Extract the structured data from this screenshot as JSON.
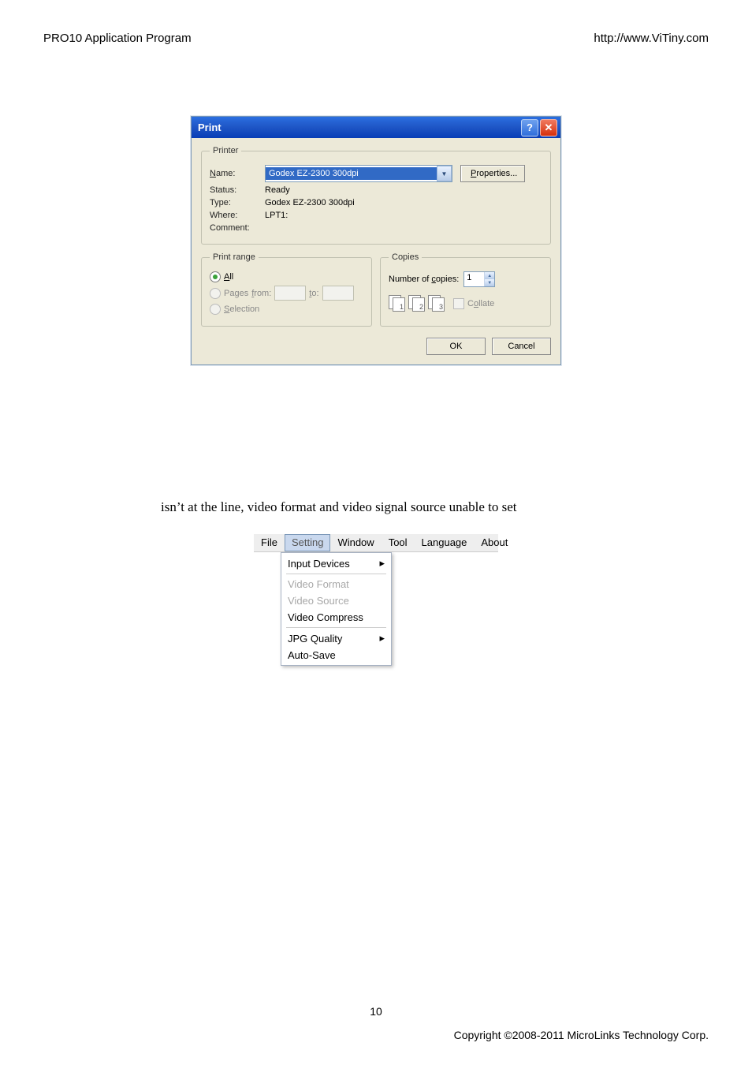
{
  "header": {
    "left": "PRO10 Application Program",
    "right": "http://www.ViTiny.com"
  },
  "dialog": {
    "title": "Print",
    "printer_group": "Printer",
    "name_label": "Name:",
    "name_value": "Godex EZ-2300 300dpi",
    "properties_btn": "Properties...",
    "status_label": "Status:",
    "status_value": "Ready",
    "type_label": "Type:",
    "type_value": "Godex EZ-2300 300dpi",
    "where_label": "Where:",
    "where_value": "LPT1:",
    "comment_label": "Comment:",
    "comment_value": "",
    "range_group": "Print range",
    "range_all": "All",
    "range_pages": "Pages",
    "range_from": "from:",
    "range_to": "to:",
    "range_selection": "Selection",
    "copies_group": "Copies",
    "copies_label": "Number of copies:",
    "copies_value": "1",
    "collate_label": "Collate",
    "icon_pages": {
      "a": "1",
      "b": "2",
      "c": "3"
    },
    "ok": "OK",
    "cancel": "Cancel"
  },
  "paragraph": "isn’t at the line, video format and video signal source unable to set",
  "menu": {
    "bar": [
      "File",
      "Setting",
      "Window",
      "Tool",
      "Language",
      "About"
    ],
    "items": {
      "input_devices": "Input Devices",
      "video_format": "Video Format",
      "video_source": "Video Source",
      "video_compress": "Video Compress",
      "jpg_quality": "JPG Quality",
      "auto_save": "Auto-Save"
    }
  },
  "footer": {
    "page": "10",
    "copyright": "Copyright ©2008-2011 MicroLinks Technology Corp."
  }
}
